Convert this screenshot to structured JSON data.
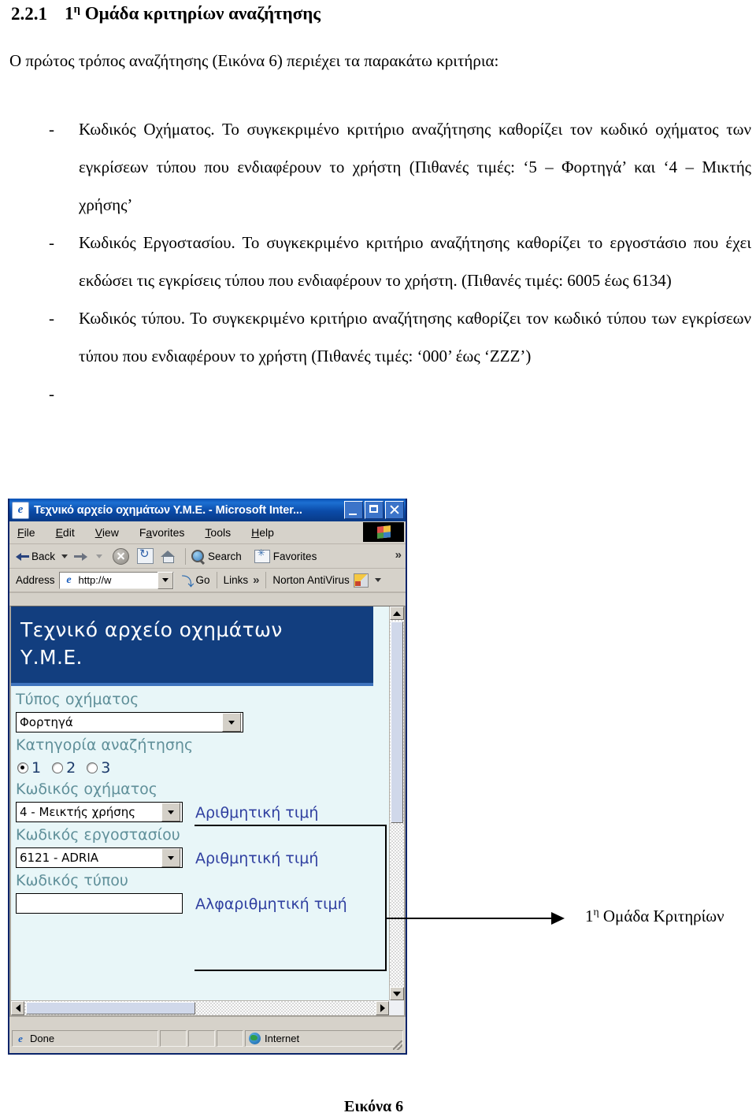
{
  "document": {
    "heading_number": "2.2.1",
    "heading_text_pre": "1",
    "heading_sup": "η",
    "heading_text_post": " Ομάδα κριτηρίων αναζήτησης",
    "intro": "Ο πρώτος τρόπος αναζήτησης (Εικόνα 6) περιέχει τα παρακάτω κριτήρια:",
    "bullets": [
      {
        "dash": "-",
        "text": "Κωδικός Οχήματος.  Το συγκεκριμένο κριτήριο αναζήτησης καθορίζει τον κωδικό οχήματος των εγκρίσεων τύπου που ενδιαφέρουν το χρήστη (Πιθανές τιμές: ‘5 – Φορτηγά’ και ‘4 – Μικτής χρήσης’"
      },
      {
        "dash": "-",
        "text": "Κωδικός Εργοστασίου.  Το συγκεκριμένο κριτήριο αναζήτησης καθορίζει το εργοστάσιο που έχει εκδώσει τις εγκρίσεις τύπου που ενδιαφέρουν το χρήστη. (Πιθανές τιμές: 6005 έως 6134)"
      },
      {
        "dash": "-",
        "text": "Κωδικός τύπου. Το συγκεκριμένο κριτήριο αναζήτησης καθορίζει τον κωδικό τύπου των εγκρίσεων τύπου που ενδιαφέρουν το χρήστη (Πιθανές τιμές: ‘000’ έως ‘ZZZ’)"
      },
      {
        "dash": "-",
        "text": ""
      }
    ],
    "figure_caption": "Εικόνα 6"
  },
  "annotation": {
    "label_pre": "1",
    "label_sup": "η",
    "label_post": " Ομάδα Κριτηρίων"
  },
  "browser": {
    "title": "Τεχνικό αρχείο οχημάτων Υ.Μ.Ε. - Microsoft Inter...",
    "title_icon": "e",
    "window_buttons": {
      "minimize": "minimize",
      "maximize": "maximize",
      "close": "close"
    },
    "menu": [
      "File",
      "Edit",
      "View",
      "Favorites",
      "Tools",
      "Help"
    ],
    "toolbar": {
      "back": "Back",
      "forward": "",
      "stop": "stop",
      "refresh": "refresh",
      "home": "home",
      "search": "Search",
      "favorites": "Favorites",
      "overflow": "»"
    },
    "addressbar": {
      "label": "Address",
      "value": "http://w",
      "go": "Go",
      "links": "Links",
      "links_overflow": "»",
      "norton": "Norton AntiVirus"
    },
    "statusbar": {
      "status": "Done",
      "zone": "Internet"
    }
  },
  "page": {
    "banner_title": "Τεχνικό αρχείο οχημάτων\nΥ.Μ.Ε.",
    "fields": [
      {
        "label": "Τύπος οχήματος",
        "type": "select",
        "value": "Φορτηγά",
        "hint": ""
      },
      {
        "label": "Κατηγορία αναζήτησης",
        "type": "radio",
        "options": [
          "1",
          "2",
          "3"
        ],
        "selected": "1",
        "hint": ""
      },
      {
        "label": "Κωδικός οχήματος",
        "type": "select",
        "value": "4 - Μεικτής χρήσης",
        "hint": "Αριθμητική τιμή"
      },
      {
        "label": "Κωδικός εργοστασίου",
        "type": "select",
        "value": "6121 - ADRIA",
        "hint": "Αριθμητική τιμή"
      },
      {
        "label": "Κωδικός τύπου",
        "type": "text",
        "value": "",
        "hint": "Αλφαριθμητική τιμή"
      }
    ]
  },
  "colors": {
    "banner_bg": "#123e7f",
    "page_bg": "#e8f6f8",
    "label_color": "#5f8f99",
    "hint_color": "#2f3fa0",
    "titlebar": "#0b4ba8"
  }
}
